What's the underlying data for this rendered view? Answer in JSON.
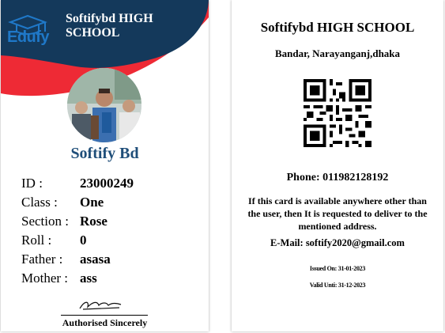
{
  "front": {
    "logo_text": "Edufy",
    "school_name": "Softifybd HIGH SCHOOL",
    "holder_name": "Softify Bd",
    "fields": [
      {
        "label": "ID :",
        "value": "23000249"
      },
      {
        "label": "Class :",
        "value": "One"
      },
      {
        "label": "Section :",
        "value": "Rose"
      },
      {
        "label": "Roll :",
        "value": "0"
      },
      {
        "label": "Father :",
        "value": "asasa"
      },
      {
        "label": "Mother :",
        "value": "ass"
      }
    ],
    "signature_label": "Authorised Sincerely"
  },
  "back": {
    "school_name": "Softifybd HIGH SCHOOL",
    "address": "Bandar, Narayanganj,dhaka",
    "phone": "Phone: 011982128192",
    "notice": "If this card is available anywhere other than the user, then It is requested to deliver to the mentioned address.",
    "email": "E-Mail: softify2020@gmail.com",
    "issued": "Issued On: 31-01-2023",
    "valid": "Valid Unti: 31-12-2023"
  },
  "colors": {
    "navy": "#14395b",
    "red": "#ee2a35",
    "name_blue": "#1f4e79",
    "logo_blue": "#1f78c8"
  }
}
